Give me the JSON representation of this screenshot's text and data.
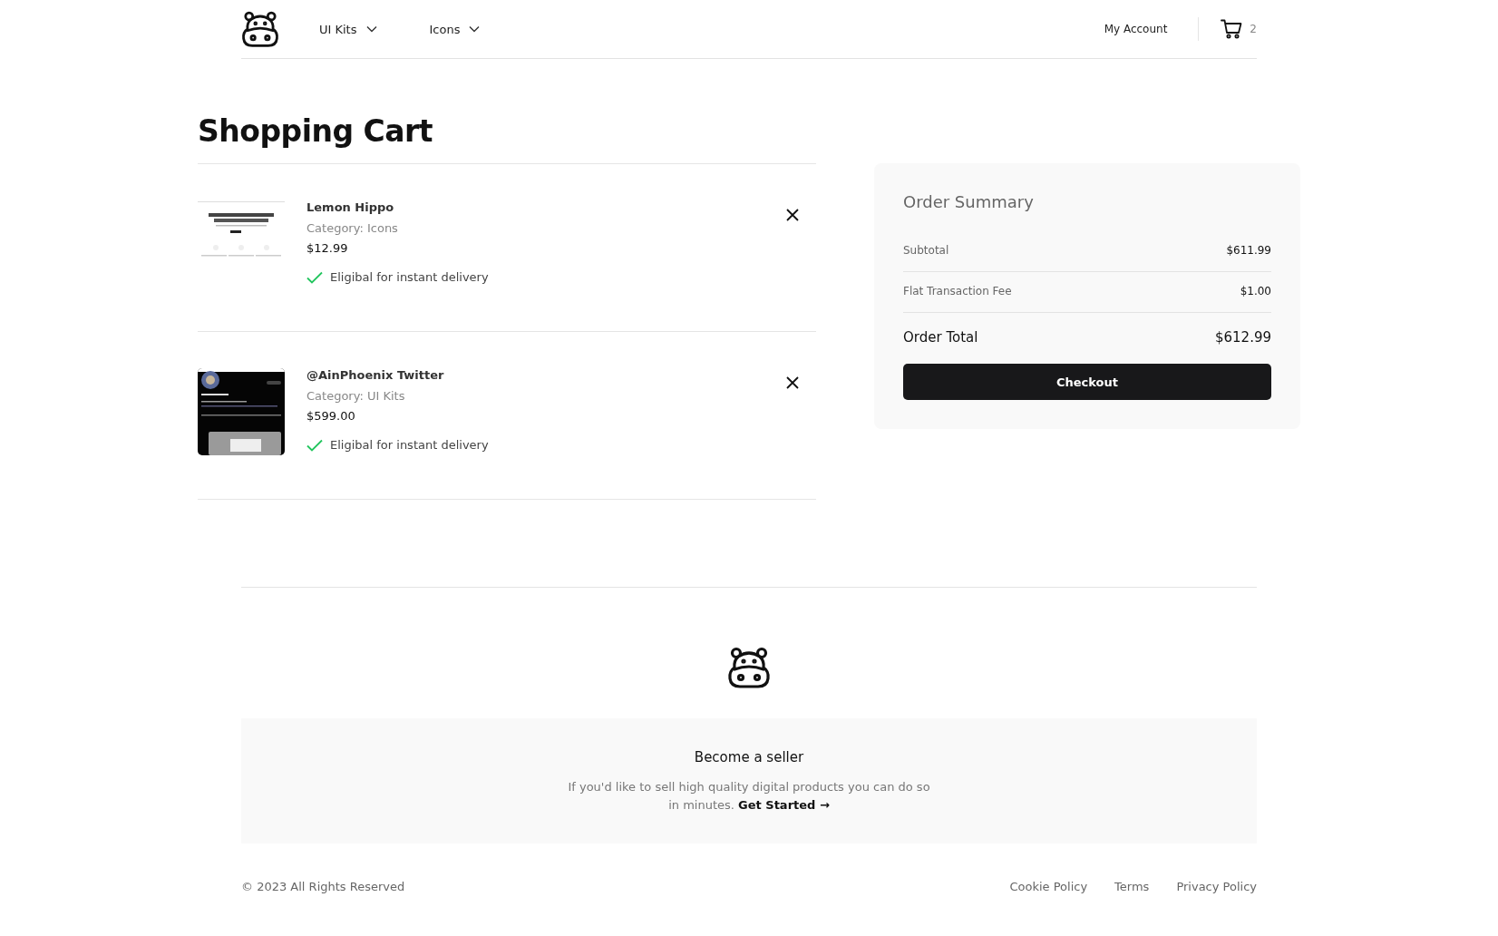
{
  "header": {
    "nav": [
      {
        "label": "UI Kits"
      },
      {
        "label": "Icons"
      }
    ],
    "account": "My Account",
    "cart_count": "2"
  },
  "title": "Shopping Cart",
  "items": [
    {
      "kind": "light",
      "name": "Lemon Hippo",
      "category": "Category: Icons",
      "price": "$12.99",
      "delivery": "Eligibal for instant delivery"
    },
    {
      "kind": "dark",
      "name": "@AinPhoenix Twitter",
      "category": "Category: UI Kits",
      "price": "$599.00",
      "delivery": "Eligibal for instant delivery"
    }
  ],
  "summary": {
    "title": "Order Summary",
    "rows": [
      {
        "label": "Subtotal",
        "value": "$611.99"
      },
      {
        "label": "Flat Transaction Fee",
        "value": "$1.00"
      }
    ],
    "total_label": "Order Total",
    "total": "$612.99",
    "button": "Checkout"
  },
  "seller": {
    "title": "Become a seller",
    "text": "If you'd like to sell high quality digital products you can do so in minutes.",
    "link": "Get Started →"
  },
  "footer": {
    "copyright": "© 2023 All Rights Reserved",
    "links": [
      "Cookie Policy",
      "Terms",
      "Privacy Policy"
    ]
  }
}
